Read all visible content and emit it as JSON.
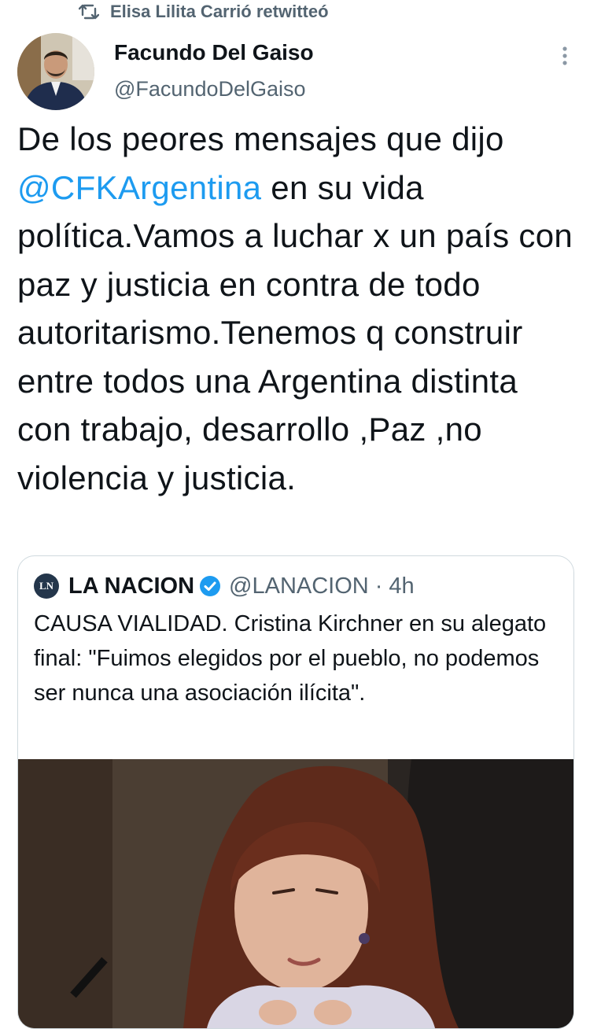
{
  "retweet": {
    "icon": "retweet-icon",
    "text": "Elisa Lilita Carrió retwitteó"
  },
  "author": {
    "name": "Facundo Del Gaiso",
    "handle": "@FacundoDelGaiso",
    "avatar": "avatar-photo"
  },
  "tweet": {
    "text_before": "De los peores mensajes que dijo ",
    "mention": "@CFKArgentina",
    "text_after": " en su vida política.Vamos a luchar x un país con paz y justicia en contra de todo autoritarismo.Tenemos q construir entre todos una Argentina distinta con trabajo, desarrollo ,Paz ,no violencia y justicia."
  },
  "quote": {
    "logo_text": "LN",
    "name": "LA NACION",
    "verified_icon": "verified-badge-icon",
    "handle": "@LANACION",
    "separator": "·",
    "time": "4h",
    "text": "CAUSA VIALIDAD. Cristina Kirchner en su alegato final: \"Fuimos elegidos por el pueblo, no podemos ser nunca una asociación ilícita\"."
  },
  "colors": {
    "link": "#1d9bf0",
    "secondary": "#536471",
    "border": "#cfd9de",
    "verified": "#1d9bf0"
  }
}
